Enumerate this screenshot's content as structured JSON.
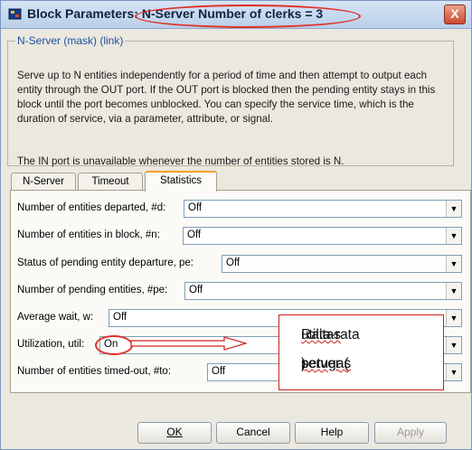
{
  "window": {
    "title": "Block Parameters: N-Server Number of clerks = 3",
    "close_label": "X"
  },
  "group": {
    "legend": "N-Server (mask) (link)",
    "description": "Serve up to N entities independently for a period of time and then attempt to output each entity through the OUT port. If the OUT port is blocked then the pending entity stays in this block until the port becomes unblocked. You can specify the service time, which is the duration of service, via a parameter, attribute, or signal.",
    "note": "The IN port is unavailable whenever the number of entities stored is N."
  },
  "tabs": [
    {
      "label": "N-Server",
      "active": false
    },
    {
      "label": "Timeout",
      "active": false
    },
    {
      "label": "Statistics",
      "active": true
    }
  ],
  "params": [
    {
      "label": "Number of entities departed, #d:",
      "value": "Off"
    },
    {
      "label": "Number of entities in block, #n:",
      "value": "Off"
    },
    {
      "label": "Status of pending entity departure, pe:",
      "value": "Off"
    },
    {
      "label": "Number of pending entities, #pe:",
      "value": "Off"
    },
    {
      "label": "Average wait, w:",
      "value": "Off"
    },
    {
      "label": "Utilization, util:",
      "value": "On"
    },
    {
      "label": "Number of entities timed-out, #to:",
      "value": "Off"
    }
  ],
  "annotation": {
    "line1_a": "Rata-rata ",
    "line1_b": "utilitas",
    "line2_a": "server (",
    "line2_b": "petugas",
    "line2_c": ")",
    "color": "#d02020"
  },
  "buttons": {
    "ok": "OK",
    "cancel": "Cancel",
    "help": "Help",
    "apply": "Apply"
  },
  "icons": {
    "dropdown": "chevron-down-icon",
    "block": "simulink-block-icon"
  }
}
